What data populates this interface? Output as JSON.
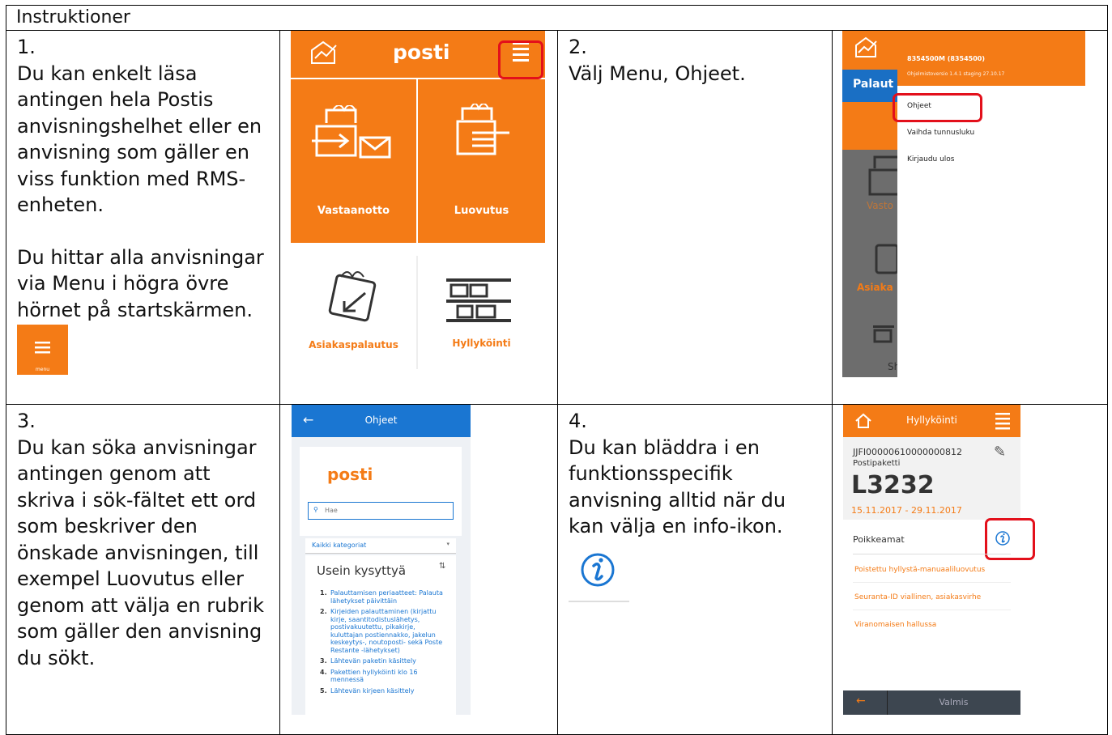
{
  "header": {
    "title": "Instruktioner"
  },
  "steps": [
    {
      "number": "1.",
      "lines": [
        "Du kan enkelt läsa",
        "antingen hela Postis",
        "anvisningshelhet eller en",
        "anvisning som gäller en",
        "viss funktion med RMS-",
        "enheten."
      ],
      "lines2": [
        "Du hittar alla anvisningar",
        "via Menu i högra övre",
        "hörnet på startskärmen."
      ],
      "menu_label": "menu"
    },
    {
      "number": "2.",
      "lines": [
        "Välj Menu, Ohjeet."
      ]
    },
    {
      "number": "3.",
      "lines": [
        "Du kan söka anvisningar",
        "antingen genom att",
        "skriva i sök-fältet ett ord",
        "som beskriver den",
        "önskade anvisningen, till",
        "exempel Luovutus eller",
        "genom att välja en rubrik",
        "som gäller den anvisning",
        "du sökt."
      ]
    },
    {
      "number": "4.",
      "lines": [
        "Du kan bläddra i en",
        "funktionsspecifik",
        "anvisning alltid när du",
        "kan välja en info-ikon."
      ]
    }
  ],
  "shot1": {
    "logo": "posti",
    "menu_label": "menu",
    "tiles": [
      "Vastaanotto",
      "Luovutus",
      "Asiakaspalautus",
      "Hyllyköinti"
    ]
  },
  "shot2": {
    "user": "8354500M (8354500)",
    "version": "Ohjelmistoversio 1.4.1 staging 27.10.17",
    "items": [
      "Ohjeet",
      "Vaihda tunnusluku",
      "Kirjaudu ulos"
    ],
    "bg_labels": [
      "Palaut",
      "Vasto",
      "Asiaka",
      "Sh"
    ]
  },
  "shot3": {
    "title": "Ohjeet",
    "logo": "posti",
    "search_placeholder": "Hae",
    "category": "Kaikki kategoriat",
    "section": "Usein kysyttyä",
    "items": [
      {
        "n": "1.",
        "t": "Palauttamisen periaatteet: Palauta lähetykset päivittäin"
      },
      {
        "n": "2.",
        "t": "Kirjeiden palauttaminen (kirjattu kirje, saantitodistuslähetys, postivakuutettu, pikakirje, kuluttajan postiennakko, jakelun keskeytys-, noutoposti- sekä Poste Restante -lähetykset)"
      },
      {
        "n": "3.",
        "t": "Lähtevän paketin käsittely"
      },
      {
        "n": "4.",
        "t": "Pakettien hyllyköinti klo 16 mennessä"
      },
      {
        "n": "5.",
        "t": "Lähtevän kirjeen käsittely"
      }
    ]
  },
  "shot4": {
    "title": "Hyllyköinti",
    "menu_label": "menu",
    "tracking": "JJFI00000610000000812",
    "type": "Postipaketti",
    "code": "L3232",
    "dates": "15.11.2017 - 29.11.2017",
    "section": "Poikkeamat",
    "rows": [
      "Poistettu hyllystä-manuaaliluovutus",
      "Seuranta-ID viallinen, asiakasvirhe",
      "Viranomaisen hallussa"
    ],
    "done": "Valmis"
  },
  "colors": {
    "posti_orange": "#f47b16",
    "app_blue": "#1a76d2",
    "highlight_red": "#e3101b"
  }
}
